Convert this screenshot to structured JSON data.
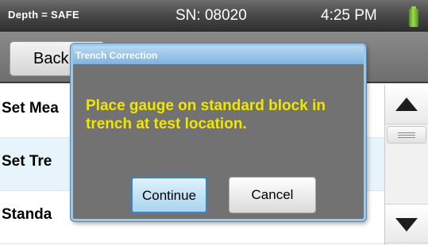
{
  "status_bar": {
    "depth_text": "Depth = SAFE",
    "serial_text": "SN: 08020",
    "time_text": "4:25 PM",
    "battery_icon": "battery-icon",
    "battery_color": "#8fd13f"
  },
  "toolbar": {
    "back_label": "Back"
  },
  "list": {
    "items": [
      {
        "label": "Set Mea",
        "selected": false
      },
      {
        "label": "Set Tre",
        "selected": true
      },
      {
        "label": "Standa",
        "selected": false
      }
    ]
  },
  "scrollbar": {
    "up_icon": "arrow-up-icon",
    "down_icon": "arrow-down-icon"
  },
  "dialog": {
    "title": "Trench Correction",
    "message": "Place gauge on standard block in trench at test location.",
    "continue_label": "Continue",
    "cancel_label": "Cancel",
    "message_color": "#f1e600",
    "title_color": "#9ec6e6"
  }
}
